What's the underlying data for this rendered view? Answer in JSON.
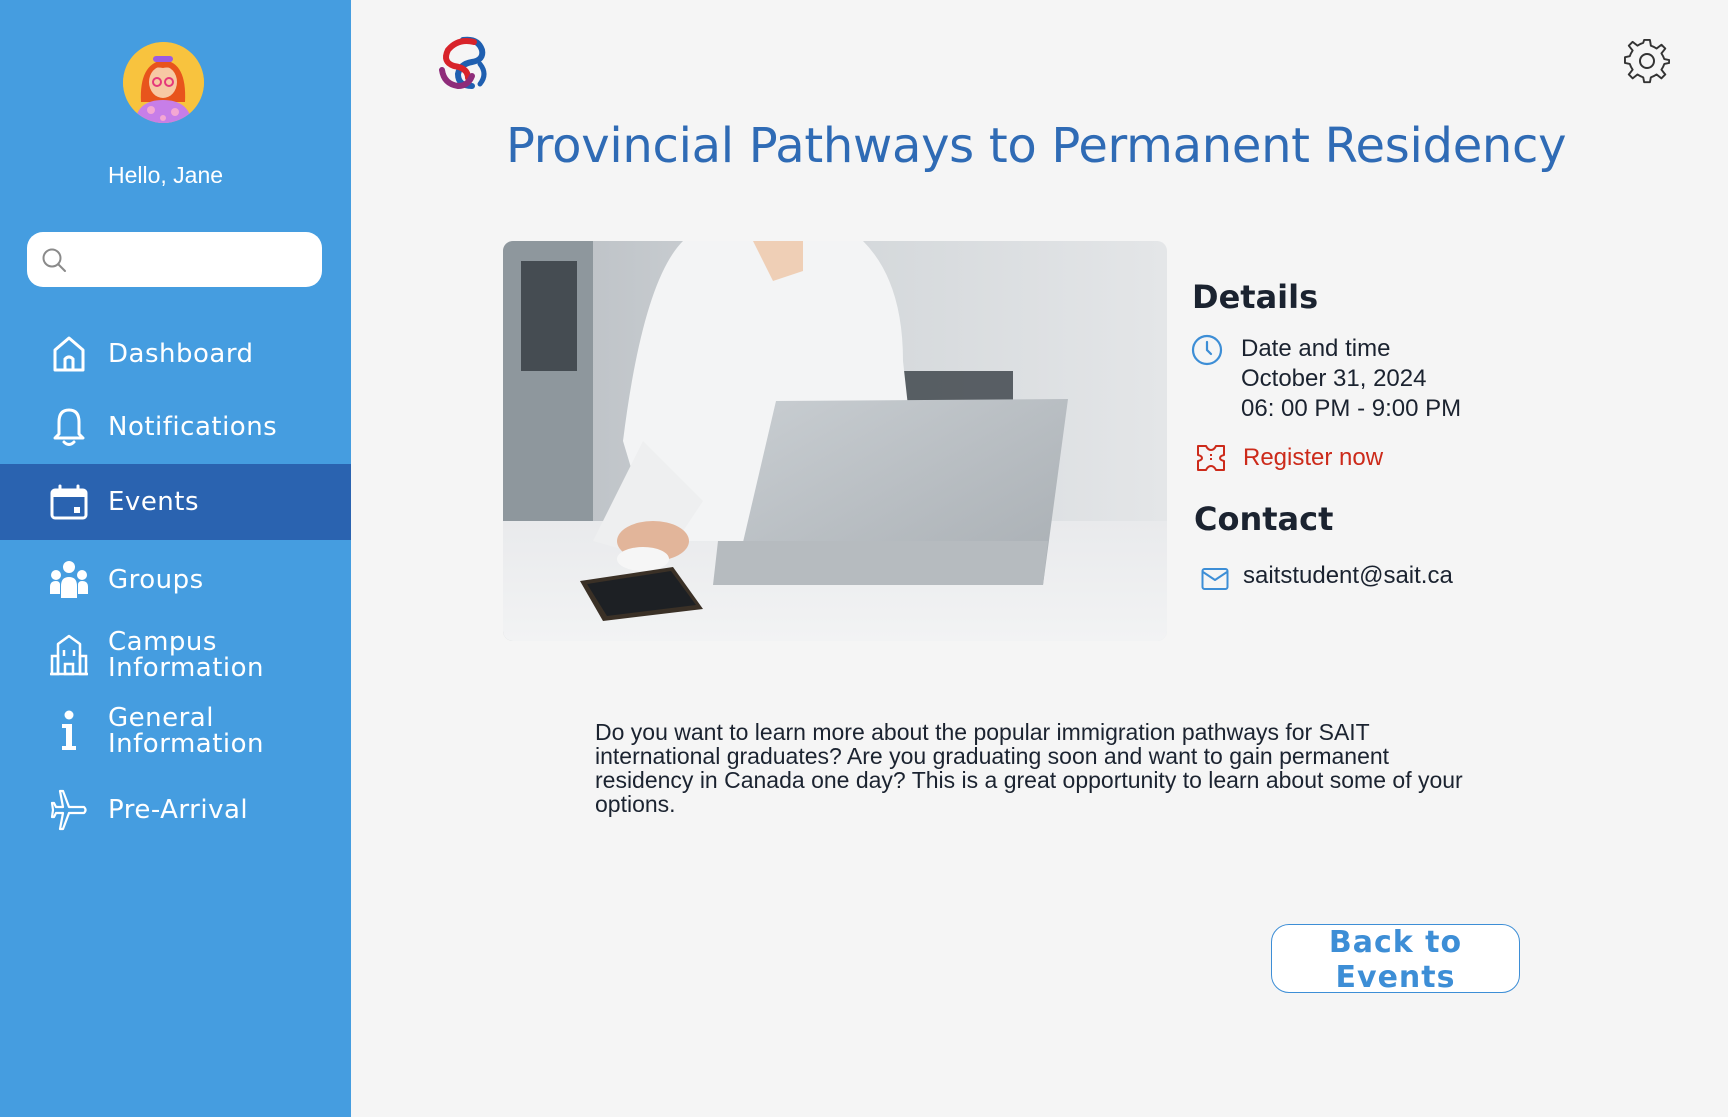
{
  "user": {
    "greeting": "Hello, Jane"
  },
  "search": {
    "placeholder": ""
  },
  "sidebar": {
    "items": [
      {
        "label": "Dashboard",
        "icon": "home-icon",
        "active": false
      },
      {
        "label": "Notifications",
        "icon": "bell-icon",
        "active": false
      },
      {
        "label": "Events",
        "icon": "calendar-icon",
        "active": true
      },
      {
        "label": "Groups",
        "icon": "group-icon",
        "active": false
      },
      {
        "label": "Campus\nInformation",
        "icon": "building-icon",
        "active": false
      },
      {
        "label": "General\nInformation",
        "icon": "info-icon",
        "active": false
      },
      {
        "label": "Pre-Arrival",
        "icon": "airplane-icon",
        "active": false
      }
    ]
  },
  "event": {
    "title": "Provincial Pathways to Permanent Residency",
    "details_heading": "Details",
    "datetime_label": "Date and time",
    "date": "October 31, 2024",
    "time": "06: 00 PM - 9:00 PM",
    "register_label": "Register now",
    "contact_heading": "Contact",
    "email": "saitstudent@sait.ca",
    "description": "Do you want to learn more about the popular immigration pathways for  SAIT international graduates? Are you graduating soon and want to gain  permanent residency in Canada one day? This is a great opportunity to  learn about some of your options."
  },
  "actions": {
    "back_label": "Back to Events"
  },
  "colors": {
    "sidebar": "#459de0",
    "sidebar_active": "#2a63b0",
    "title": "#2f6bb5",
    "register": "#cc2a1a",
    "accent": "#3d8ed6",
    "background": "#f5f5f5"
  }
}
